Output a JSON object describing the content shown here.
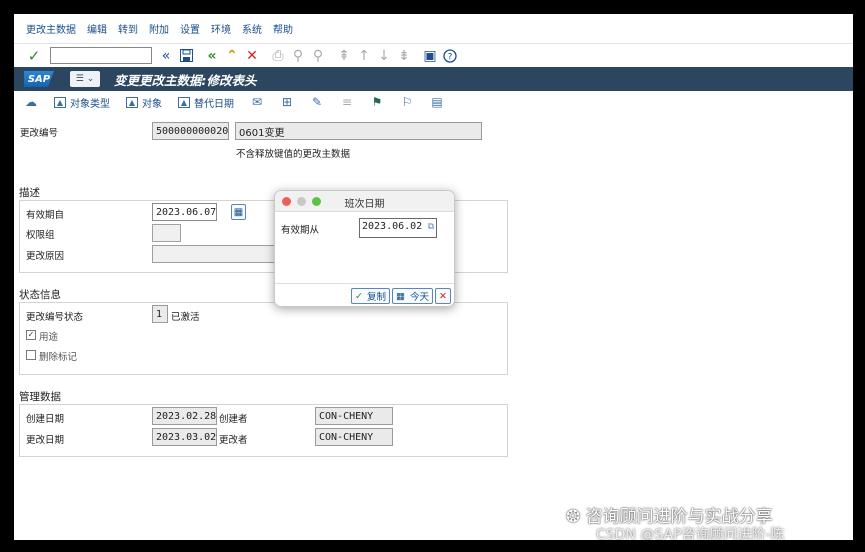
{
  "menu": [
    "更改主数据",
    "编辑",
    "转到",
    "附加",
    "设置",
    "环境",
    "系统",
    "帮助"
  ],
  "titlebar": {
    "logo": "SAP",
    "menu_icon": "☰",
    "title": "变更更改主数据:修改表头"
  },
  "app_toolbar": {
    "object_types": "对象类型",
    "objects": "对象",
    "alt_date": "替代日期"
  },
  "header": {
    "change_no_label": "更改编号",
    "change_no": "500000000020",
    "change_desc": "0601变更",
    "note": "不含释放键值的更改主数据"
  },
  "description": {
    "section": "描述",
    "valid_from_label": "有效期自",
    "valid_from": "2023.06.07",
    "auth_group_label": "权限组",
    "reason_label": "更改原因"
  },
  "status": {
    "section": "状态信息",
    "status_label": "更改编号状态",
    "status_value": "1",
    "status_text": "已激活",
    "usage_label": "用途",
    "deletion_label": "删除标记"
  },
  "admin": {
    "section": "管理数据",
    "created_on_label": "创建日期",
    "created_on": "2023.02.28",
    "created_by_label": "创建者",
    "created_by": "CON-CHENY",
    "changed_on_label": "更改日期",
    "changed_on": "2023.03.02",
    "changed_by_label": "更改者",
    "changed_by": "CON-CHENY"
  },
  "dialog": {
    "title": "班次日期",
    "field_label": "有效期从",
    "field_value": "2023.06.02",
    "copy_label": "复制",
    "today_label": "今天"
  },
  "watermark": {
    "line1": "咨询顾问进阶与实战分享",
    "line2": "CSDN @SAP咨询顾问进阶-陈"
  },
  "colors": {
    "titlebar": "#2c4660",
    "link": "#1a4f8b",
    "confirm_green": "#2e8b2e",
    "cancel_red": "#d22"
  }
}
